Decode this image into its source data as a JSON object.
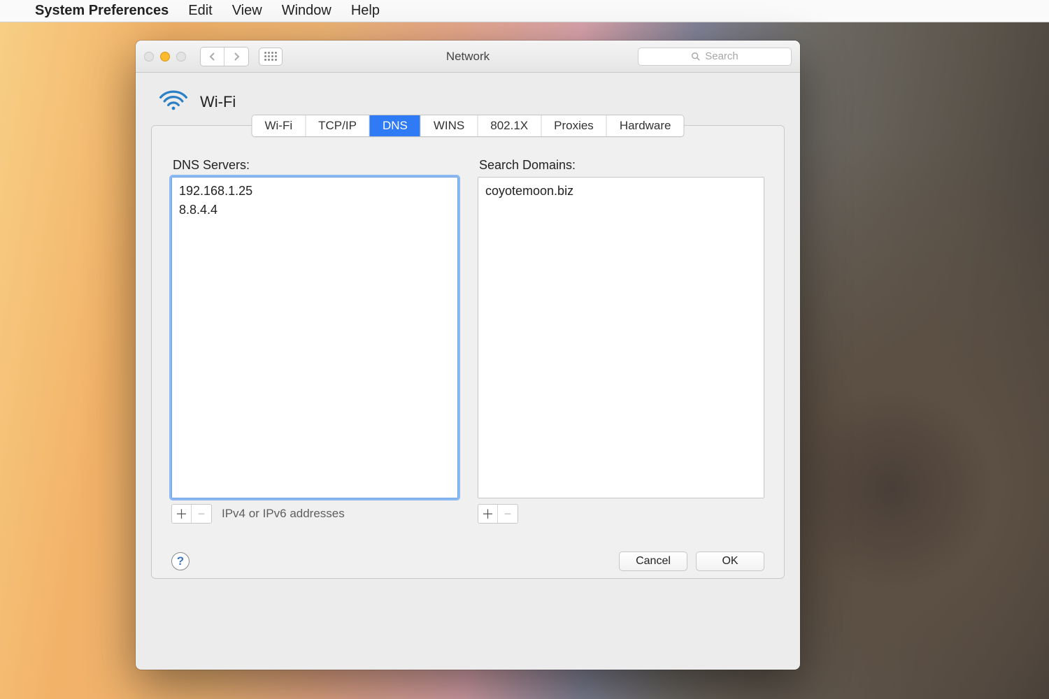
{
  "menubar": {
    "app": "System Preferences",
    "items": [
      "Edit",
      "View",
      "Window",
      "Help"
    ]
  },
  "window": {
    "title": "Network",
    "search_placeholder": "Search"
  },
  "connection": {
    "name": "Wi-Fi"
  },
  "tabs": [
    "Wi-Fi",
    "TCP/IP",
    "DNS",
    "WINS",
    "802.1X",
    "Proxies",
    "Hardware"
  ],
  "active_tab": "DNS",
  "dns": {
    "servers_label": "DNS Servers:",
    "servers": [
      "192.168.1.25",
      "8.8.4.4"
    ],
    "hint": "IPv4 or IPv6 addresses",
    "domains_label": "Search Domains:",
    "domains": [
      "coyotemoon.biz"
    ]
  },
  "buttons": {
    "cancel": "Cancel",
    "ok": "OK"
  }
}
